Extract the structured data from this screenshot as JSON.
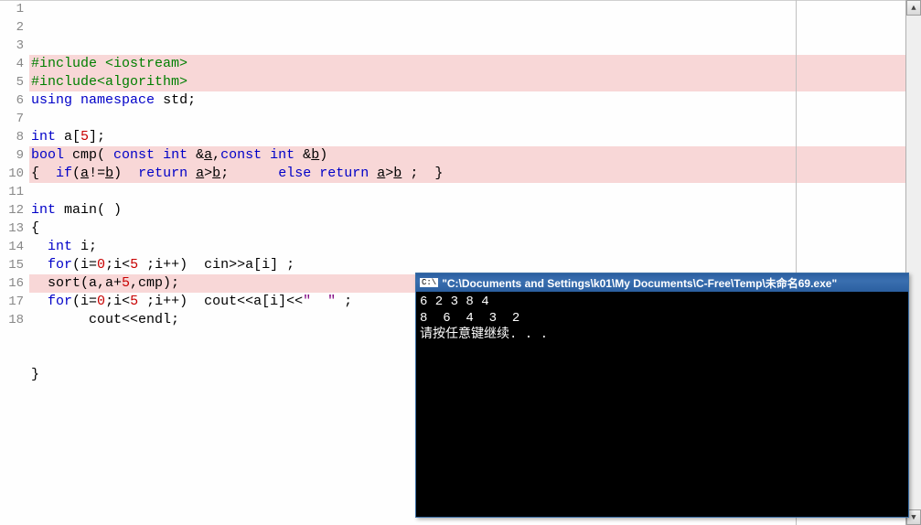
{
  "editor": {
    "lines": [
      {
        "num": 1,
        "hl": true,
        "segments": [
          [
            "kw-pp",
            "#include"
          ],
          [
            "sym",
            " "
          ],
          [
            "kw-pp",
            "<iostream>"
          ]
        ]
      },
      {
        "num": 2,
        "hl": true,
        "segments": [
          [
            "kw-pp",
            "#include<algorithm>"
          ]
        ]
      },
      {
        "num": 3,
        "hl": false,
        "segments": [
          [
            "kw-blue",
            "using"
          ],
          [
            "sym",
            " "
          ],
          [
            "kw-blue",
            "namespace"
          ],
          [
            "sym",
            " "
          ],
          [
            "ident",
            "std"
          ],
          [
            "sym",
            ";"
          ]
        ]
      },
      {
        "num": 4,
        "hl": false,
        "segments": []
      },
      {
        "num": 5,
        "hl": false,
        "segments": [
          [
            "kw-blue",
            "int"
          ],
          [
            "sym",
            " a["
          ],
          [
            "kw-red",
            "5"
          ],
          [
            "sym",
            "];"
          ]
        ]
      },
      {
        "num": 6,
        "hl": true,
        "segments": [
          [
            "kw-blue",
            "bool"
          ],
          [
            "sym",
            " cmp( "
          ],
          [
            "kw-blue",
            "const"
          ],
          [
            "sym",
            " "
          ],
          [
            "kw-blue",
            "int"
          ],
          [
            "sym",
            " &"
          ],
          [
            "underline",
            "a"
          ],
          [
            "sym",
            ","
          ],
          [
            "kw-blue",
            "const"
          ],
          [
            "sym",
            " "
          ],
          [
            "kw-blue",
            "int"
          ],
          [
            "sym",
            " &"
          ],
          [
            "underline",
            "b"
          ],
          [
            "sym",
            ")"
          ]
        ]
      },
      {
        "num": 7,
        "hl": true,
        "segments": [
          [
            "sym",
            "{  "
          ],
          [
            "kw-blue",
            "if"
          ],
          [
            "sym",
            "("
          ],
          [
            "underline",
            "a"
          ],
          [
            "sym",
            "!="
          ],
          [
            "underline",
            "b"
          ],
          [
            "sym",
            ")  "
          ],
          [
            "kw-blue",
            "return"
          ],
          [
            "sym",
            " "
          ],
          [
            "underline",
            "a"
          ],
          [
            "sym",
            ">"
          ],
          [
            "underline",
            "b"
          ],
          [
            "sym",
            ";      "
          ],
          [
            "kw-blue",
            "else"
          ],
          [
            "sym",
            " "
          ],
          [
            "kw-blue",
            "return"
          ],
          [
            "sym",
            " "
          ],
          [
            "underline",
            "a"
          ],
          [
            "sym",
            ">"
          ],
          [
            "underline",
            "b"
          ],
          [
            "sym",
            " ;  }"
          ]
        ]
      },
      {
        "num": 8,
        "hl": false,
        "segments": []
      },
      {
        "num": 9,
        "hl": false,
        "segments": [
          [
            "kw-blue",
            "int"
          ],
          [
            "sym",
            " main( )"
          ]
        ]
      },
      {
        "num": 10,
        "hl": false,
        "segments": [
          [
            "sym",
            "{"
          ]
        ]
      },
      {
        "num": 11,
        "hl": false,
        "segments": [
          [
            "sym",
            "  "
          ],
          [
            "kw-blue",
            "int"
          ],
          [
            "sym",
            " i;"
          ]
        ]
      },
      {
        "num": 12,
        "hl": false,
        "segments": [
          [
            "sym",
            "  "
          ],
          [
            "kw-blue",
            "for"
          ],
          [
            "sym",
            "(i="
          ],
          [
            "kw-red",
            "0"
          ],
          [
            "sym",
            ";i<"
          ],
          [
            "kw-red",
            "5"
          ],
          [
            "sym",
            " ;i++)  cin>>a[i] ;"
          ]
        ]
      },
      {
        "num": 13,
        "hl": true,
        "segments": [
          [
            "sym",
            "  sort(a,a+"
          ],
          [
            "kw-red",
            "5"
          ],
          [
            "sym",
            ",cmp);"
          ]
        ]
      },
      {
        "num": 14,
        "hl": false,
        "segments": [
          [
            "sym",
            "  "
          ],
          [
            "kw-blue",
            "for"
          ],
          [
            "sym",
            "(i="
          ],
          [
            "kw-red",
            "0"
          ],
          [
            "sym",
            ";i<"
          ],
          [
            "kw-red",
            "5"
          ],
          [
            "sym",
            " ;i++)  cout<<a[i]<<"
          ],
          [
            "str",
            "\"  \""
          ],
          [
            "sym",
            " ;"
          ]
        ]
      },
      {
        "num": 15,
        "hl": false,
        "segments": [
          [
            "sym",
            "       cout<<endl;"
          ]
        ]
      },
      {
        "num": 16,
        "hl": false,
        "segments": []
      },
      {
        "num": 17,
        "hl": false,
        "segments": []
      },
      {
        "num": 18,
        "hl": false,
        "segments": [
          [
            "sym",
            "}"
          ]
        ]
      }
    ]
  },
  "console": {
    "icon_label": "C:\\",
    "title": "\"C:\\Documents and Settings\\k01\\My Documents\\C-Free\\Temp\\未命名69.exe\"",
    "lines": [
      "6 2 3 8 4",
      "8  6  4  3  2",
      "请按任意键继续. . ."
    ]
  },
  "scrollbar": {
    "up": "▲",
    "down": "▼"
  }
}
